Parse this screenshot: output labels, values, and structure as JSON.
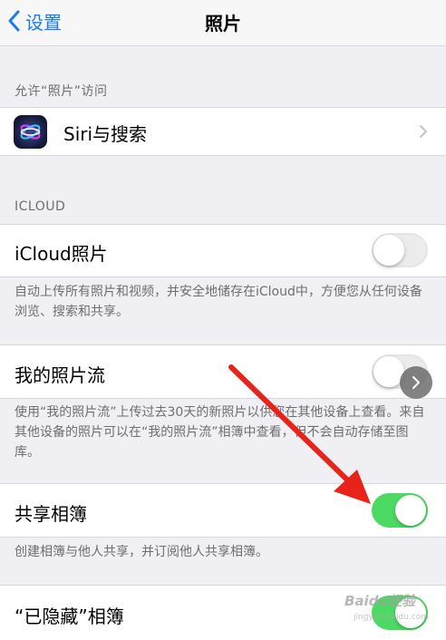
{
  "nav": {
    "back_label": "设置",
    "title": "照片"
  },
  "allow_access": {
    "header": "允许“照片”访问",
    "siri_label": "Siri与搜索"
  },
  "icloud": {
    "header": "ICLOUD",
    "icloud_photos_label": "iCloud照片",
    "icloud_photos_on": false,
    "icloud_photos_footer": "自动上传所有照片和视频，并安全地储存在iCloud中，方便您从任何设备浏览、搜索和共享。",
    "photo_stream_label": "我的照片流",
    "photo_stream_on": false,
    "photo_stream_footer": "使用“我的照片流”上传过去30天的新照片以供您在其他设备上查看。来自其他设备的照片可以在“我的照片流”相簿中查看，但不会自动存储至图库。",
    "shared_albums_label": "共享相簿",
    "shared_albums_on": true,
    "shared_albums_footer": "创建相簿与他人共享，并订阅他人共享相簿。",
    "hidden_album_label": "“已隐藏”相簿",
    "hidden_album_on": true
  },
  "colors": {
    "accent": "#1a7cf5",
    "toggle_on": "#4cd964",
    "annotation_arrow": "#e8231a"
  },
  "watermark": {
    "text": "Baidu经验",
    "sub": "jingyan.baidu.com"
  }
}
